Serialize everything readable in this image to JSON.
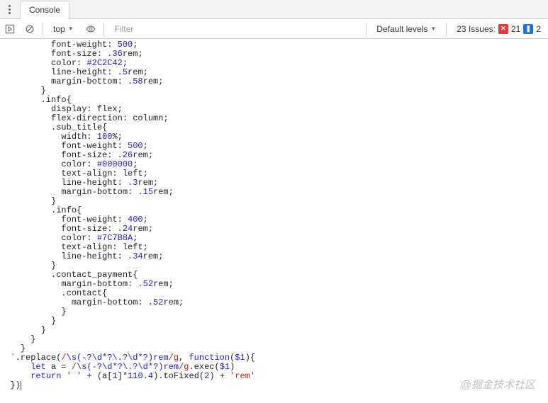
{
  "tabs": {
    "console": "Console"
  },
  "toolbar": {
    "context": "top",
    "filter_placeholder": "Filter",
    "levels": "Default levels",
    "issues_label": "23 Issues:",
    "errors": "21",
    "infos": "2"
  },
  "code": {
    "lines": [
      [
        [
          "p",
          "          font-weight: "
        ],
        [
          "n",
          "500"
        ],
        [
          "p",
          ";"
        ]
      ],
      [
        [
          "p",
          "          font-size: "
        ],
        [
          "n",
          ".36"
        ],
        [
          "p",
          "rem;"
        ]
      ],
      [
        [
          "p",
          "          color: "
        ],
        [
          "n",
          "#2C2C42"
        ],
        [
          "p",
          ";"
        ]
      ],
      [
        [
          "p",
          "          line-height: "
        ],
        [
          "n",
          ".5"
        ],
        [
          "p",
          "rem;"
        ]
      ],
      [
        [
          "p",
          "          margin-bottom: "
        ],
        [
          "n",
          ".58"
        ],
        [
          "p",
          "rem;"
        ]
      ],
      [
        [
          "p",
          "        }"
        ]
      ],
      [
        [
          "p",
          "        .info{"
        ]
      ],
      [
        [
          "p",
          "          display: flex;"
        ]
      ],
      [
        [
          "p",
          "          flex-direction: column;"
        ]
      ],
      [
        [
          "p",
          "          .sub_title{"
        ]
      ],
      [
        [
          "p",
          "            width: "
        ],
        [
          "n",
          "100"
        ],
        [
          "p",
          "%;"
        ]
      ],
      [
        [
          "p",
          "            font-weight: "
        ],
        [
          "n",
          "500"
        ],
        [
          "p",
          ";"
        ]
      ],
      [
        [
          "p",
          "            font-size: "
        ],
        [
          "n",
          ".26"
        ],
        [
          "p",
          "rem;"
        ]
      ],
      [
        [
          "p",
          "            color: "
        ],
        [
          "n",
          "#000000"
        ],
        [
          "p",
          ";"
        ]
      ],
      [
        [
          "p",
          "            text-align: left;"
        ]
      ],
      [
        [
          "p",
          "            line-height: "
        ],
        [
          "n",
          ".3"
        ],
        [
          "p",
          "rem;"
        ]
      ],
      [
        [
          "p",
          "            margin-bottom: "
        ],
        [
          "n",
          ".15"
        ],
        [
          "p",
          "rem;"
        ]
      ],
      [
        [
          "p",
          "          }"
        ]
      ],
      [
        [
          "p",
          "          .info{"
        ]
      ],
      [
        [
          "p",
          "            font-weight: "
        ],
        [
          "n",
          "400"
        ],
        [
          "p",
          ";"
        ]
      ],
      [
        [
          "p",
          "            font-size: "
        ],
        [
          "n",
          ".24"
        ],
        [
          "p",
          "rem;"
        ]
      ],
      [
        [
          "p",
          "            color: "
        ],
        [
          "n",
          "#7C7B8A"
        ],
        [
          "p",
          ";"
        ]
      ],
      [
        [
          "p",
          "            text-align: left;"
        ]
      ],
      [
        [
          "p",
          "            line-height: "
        ],
        [
          "n",
          ".34"
        ],
        [
          "p",
          "rem;"
        ]
      ],
      [
        [
          "p",
          "          }"
        ]
      ],
      [
        [
          "p",
          "          .contact_payment{"
        ]
      ],
      [
        [
          "p",
          "            margin-bottom: "
        ],
        [
          "n",
          ".52"
        ],
        [
          "p",
          "rem;"
        ]
      ],
      [
        [
          "p",
          "            .contact{"
        ]
      ],
      [
        [
          "p",
          "              margin-bottom: "
        ],
        [
          "n",
          ".52"
        ],
        [
          "p",
          "rem;"
        ]
      ],
      [
        [
          "p",
          "            }"
        ]
      ],
      [
        [
          "p",
          "          }"
        ]
      ],
      [
        [
          "p",
          "        }"
        ]
      ],
      [
        [
          "p",
          "      }"
        ]
      ],
      [
        [
          "p",
          "    }"
        ]
      ],
      [
        [
          "p",
          "  `"
        ],
        [
          "p",
          ".replace("
        ],
        [
          "ro",
          "/"
        ],
        [
          "ri",
          "\\s(-?\\d*?\\.?\\d*?)rem"
        ],
        [
          "ro",
          "/g"
        ],
        [
          "p",
          ", "
        ],
        [
          "k",
          "function"
        ],
        [
          "p",
          "("
        ],
        [
          "n",
          "$1"
        ],
        [
          "p",
          "){"
        ]
      ],
      [
        [
          "p",
          "      "
        ],
        [
          "k",
          "let"
        ],
        [
          "p",
          " a = "
        ],
        [
          "ro",
          "/"
        ],
        [
          "ri",
          "\\s(-?\\d*?\\.?\\d*?)rem"
        ],
        [
          "ro",
          "/g"
        ],
        [
          "p",
          ".exec("
        ],
        [
          "n",
          "$1"
        ],
        [
          "p",
          ")"
        ]
      ],
      [
        [
          "p",
          "      "
        ],
        [
          "k",
          "return"
        ],
        [
          "p",
          " "
        ],
        [
          "s",
          "' '"
        ],
        [
          "p",
          " + (a["
        ],
        [
          "n",
          "1"
        ],
        [
          "p",
          "]*"
        ],
        [
          "n",
          "110.4"
        ],
        [
          "p",
          ").toFixed("
        ],
        [
          "n",
          "2"
        ],
        [
          "p",
          ") + "
        ],
        [
          "s",
          "'rem'"
        ]
      ],
      [
        [
          "p",
          "  })"
        ],
        [
          "cur",
          ""
        ]
      ]
    ]
  },
  "watermark": "@掘金技术社区"
}
